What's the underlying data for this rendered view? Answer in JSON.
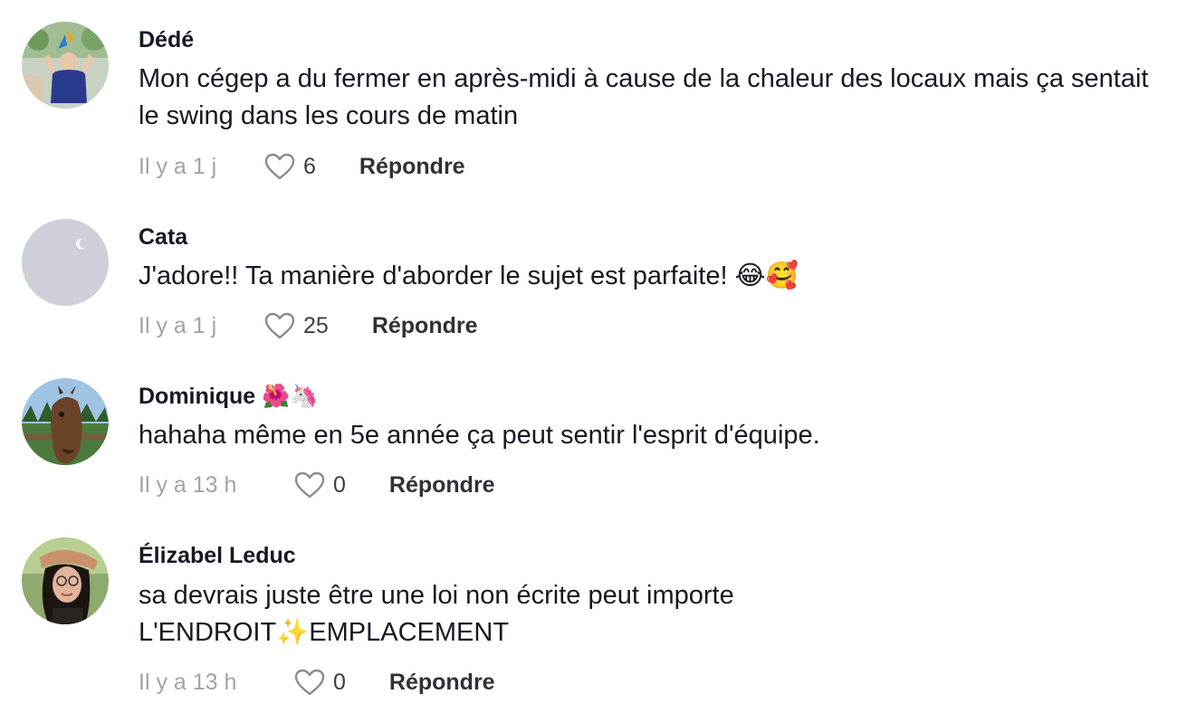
{
  "comments": [
    {
      "username": "Dédé",
      "text": "Mon cégep a du fermer en après-midi à cause de la chaleur des locaux mais ça sentait le swing dans les cours de matin",
      "time": "Il y a 1 j",
      "likes": "6",
      "reply_label": "Répondre"
    },
    {
      "username": "Cata",
      "text": "J'adore!! Ta manière d'aborder le sujet est parfaite! 😂🥰",
      "time": "Il y a 1 j",
      "likes": "25",
      "reply_label": "Répondre"
    },
    {
      "username": "Dominique 🌺🦄",
      "text": "hahaha même en 5e année ça peut sentir l'esprit d'équipe.",
      "time": "Il y a 13 h",
      "likes": "0",
      "reply_label": "Répondre"
    },
    {
      "username": "Élizabel Leduc",
      "text": "sa devrais juste être une loi non écrite peut importe L'ENDROIT✨EMPLACEMENT",
      "time": "Il y a 13 h",
      "likes": "0",
      "reply_label": "Répondre"
    }
  ],
  "icons": {
    "like": "heart-outline-icon"
  },
  "colors": {
    "text": "#161823",
    "meta": "#a2a3a8",
    "reply": "#2f3038"
  }
}
